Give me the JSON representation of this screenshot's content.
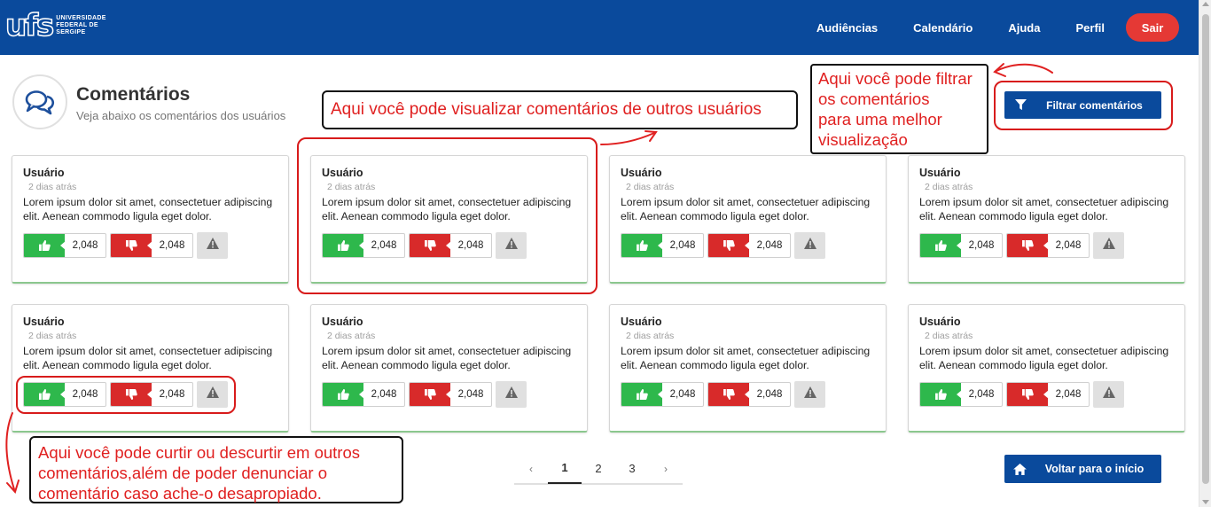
{
  "header": {
    "logo_mark": "ufs",
    "logo_line1": "UNIVERSIDADE",
    "logo_line2": "FEDERAL DE",
    "logo_line3": "SERGIPE",
    "nav": [
      "Audiências",
      "Calendário",
      "Ajuda",
      "Perfil"
    ],
    "logout": "Sair",
    "bg_color": "#0a4a9c",
    "logout_color": "#e53935"
  },
  "page": {
    "icon": "comments-icon",
    "title": "Comentários",
    "subtitle": "Veja abaixo os comentários dos usuários",
    "filter_button": "Filtrar comentários",
    "filter_icon": "filter-icon"
  },
  "comments": [
    {
      "user": "Usuário",
      "time": "2 dias atrás",
      "text": "Lorem ipsum dolor sit amet, consectetuer adipiscing elit. Aenean commodo ligula eget dolor.",
      "likes": "2,048",
      "dislikes": "2,048"
    },
    {
      "user": "Usuário",
      "time": "2 dias atrás",
      "text": "Lorem ipsum dolor sit amet, consectetuer adipiscing elit. Aenean commodo ligula eget dolor.",
      "likes": "2,048",
      "dislikes": "2,048"
    },
    {
      "user": "Usuário",
      "time": "2 dias atrás",
      "text": "Lorem ipsum dolor sit amet, consectetuer adipiscing elit. Aenean commodo ligula eget dolor.",
      "likes": "2,048",
      "dislikes": "2,048"
    },
    {
      "user": "Usuário",
      "time": "2 dias atrás",
      "text": "Lorem ipsum dolor sit amet, consectetuer adipiscing elit. Aenean commodo ligula eget dolor.",
      "likes": "2,048",
      "dislikes": "2,048"
    },
    {
      "user": "Usuário",
      "time": "2 dias atrás",
      "text": "Lorem ipsum dolor sit amet, consectetuer adipiscing elit. Aenean commodo ligula eget dolor.",
      "likes": "2,048",
      "dislikes": "2,048"
    },
    {
      "user": "Usuário",
      "time": "2 dias atrás",
      "text": "Lorem ipsum dolor sit amet, consectetuer adipiscing elit. Aenean commodo ligula eget dolor.",
      "likes": "2,048",
      "dislikes": "2,048"
    },
    {
      "user": "Usuário",
      "time": "2 dias atrás",
      "text": "Lorem ipsum dolor sit amet, consectetuer adipiscing elit. Aenean commodo ligula eget dolor.",
      "likes": "2,048",
      "dislikes": "2,048"
    },
    {
      "user": "Usuário",
      "time": "2 dias atrás",
      "text": "Lorem ipsum dolor sit amet, consectetuer adipiscing elit. Aenean commodo ligula eget dolor.",
      "likes": "2,048",
      "dislikes": "2,048"
    }
  ],
  "icons": {
    "like": "thumbs-up-icon",
    "dislike": "thumbs-down-icon",
    "report": "warning-icon"
  },
  "colors": {
    "like": "#2eb84c",
    "dislike": "#d82a2a",
    "annotation": "#e02020"
  },
  "pagination": {
    "prev": "‹",
    "pages": [
      "1",
      "2",
      "3"
    ],
    "next": "›",
    "current": "1"
  },
  "back_button": {
    "label": "Voltar para o início",
    "icon": "home-icon"
  },
  "annotations": {
    "view_comments": "Aqui você pode visualizar comentários de outros usuários",
    "filter_line1": "Aqui você pode filtrar",
    "filter_line2": "os comentários",
    "filter_line3": "para uma melhor",
    "filter_line4": "visualização",
    "vote_line1": "Aqui você pode curtir ou descurtir  em outros",
    "vote_line2": "comentários,além de poder  denunciar o",
    "vote_line3": "comentário  caso ache-o desapropiado."
  }
}
